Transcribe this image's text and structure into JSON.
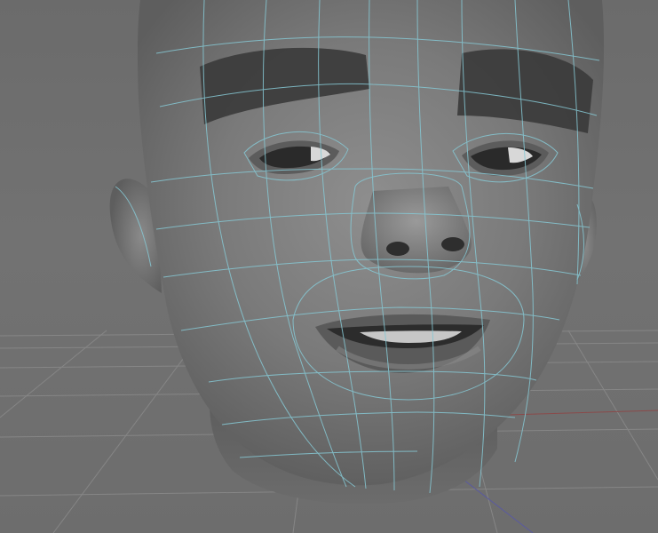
{
  "viewport": {
    "kind": "3d-perspective-viewport",
    "background_color": "#707070",
    "grid_color": "#8a8a8a",
    "axis_x_color": "#8a4a4a",
    "axis_z_color": "#5a5aa0",
    "wireframe_color": "#86c8d4",
    "model_shade_color": "#7a7a7a"
  },
  "scene": {
    "model": "head-mesh",
    "display_mode": "smooth-shaded-with-wireframe-on-shaded"
  }
}
